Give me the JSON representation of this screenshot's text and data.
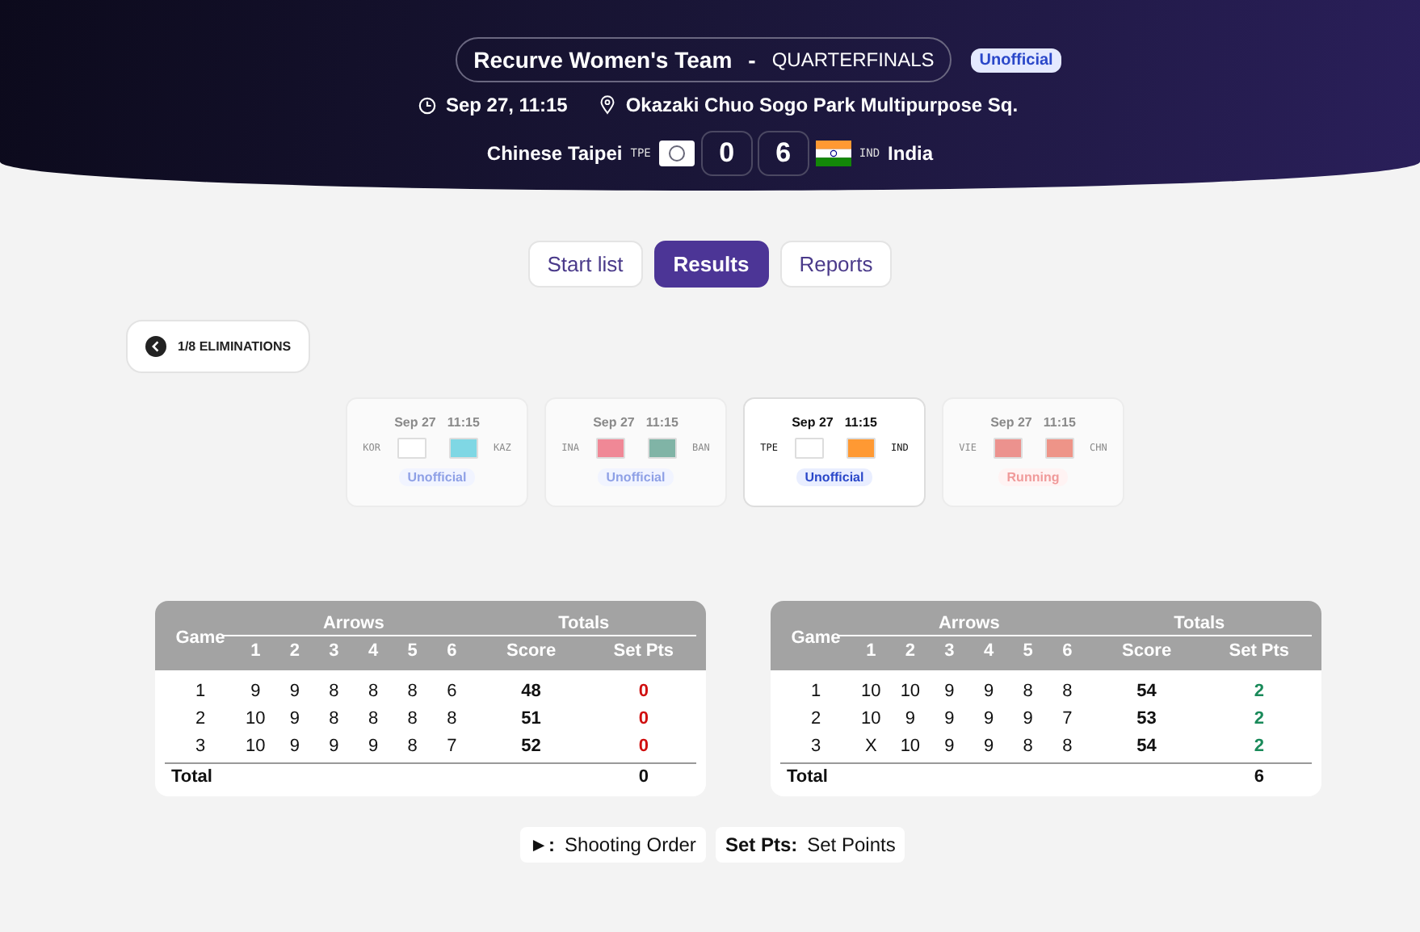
{
  "header": {
    "event": "Recurve Women's Team",
    "separator": "-",
    "phase": "QUARTERFINALS",
    "status": "Unofficial",
    "datetime": "Sep 27, 11:15",
    "venue": "Okazaki Chuo Sogo Park Multipurpose Sq.",
    "team_a": {
      "name": "Chinese Taipei",
      "code": "TPE",
      "score": "0"
    },
    "team_b": {
      "name": "India",
      "code": "IND",
      "score": "6"
    }
  },
  "tabs": [
    {
      "label": "Start list",
      "selected": false
    },
    {
      "label": "Results",
      "selected": true
    },
    {
      "label": "Reports",
      "selected": false
    }
  ],
  "back_button": {
    "label": "1/8 ELIMINATIONS"
  },
  "matches": [
    {
      "date": "Sep 27",
      "time": "11:15",
      "team_a": {
        "code": "KOR",
        "color": "#ffffff"
      },
      "team_b": {
        "code": "KAZ",
        "color": "#7fd7e4"
      },
      "status": {
        "label": "Unofficial",
        "kind": "unofficial"
      },
      "selected": false
    },
    {
      "date": "Sep 27",
      "time": "11:15",
      "team_a": {
        "code": "INA",
        "color": "#f08896"
      },
      "team_b": {
        "code": "BAN",
        "color": "#80b4a6"
      },
      "status": {
        "label": "Unofficial",
        "kind": "unofficial"
      },
      "selected": false
    },
    {
      "date": "Sep 27",
      "time": "11:15",
      "team_a": {
        "code": "TPE",
        "color": "#ffffff"
      },
      "team_b": {
        "code": "IND",
        "color": "#ff9933"
      },
      "status": {
        "label": "Unofficial",
        "kind": "unofficial"
      },
      "selected": true
    },
    {
      "date": "Sep 27",
      "time": "11:15",
      "team_a": {
        "code": "VIE",
        "color": "#ec928e"
      },
      "team_b": {
        "code": "CHN",
        "color": "#ee9488"
      },
      "status": {
        "label": "Running",
        "kind": "running"
      },
      "selected": false
    }
  ],
  "scorecards": [
    {
      "head": {
        "game": "Game",
        "arrows": "Arrows",
        "totals": "Totals",
        "arrow_numbers": [
          "1",
          "2",
          "3",
          "4",
          "5",
          "6"
        ],
        "score": "Score",
        "set_pts": "Set Pts"
      },
      "rows": [
        {
          "game": "1",
          "arrows": [
            "9",
            "9",
            "8",
            "8",
            "8",
            "6"
          ],
          "score": "48",
          "set_pts": "0",
          "won": false
        },
        {
          "game": "2",
          "arrows": [
            "10",
            "9",
            "8",
            "8",
            "8",
            "8"
          ],
          "score": "51",
          "set_pts": "0",
          "won": false
        },
        {
          "game": "3",
          "arrows": [
            "10",
            "9",
            "9",
            "9",
            "8",
            "7"
          ],
          "score": "52",
          "set_pts": "0",
          "won": false
        }
      ],
      "total_label": "Total",
      "total": "0"
    },
    {
      "head": {
        "game": "Game",
        "arrows": "Arrows",
        "totals": "Totals",
        "arrow_numbers": [
          "1",
          "2",
          "3",
          "4",
          "5",
          "6"
        ],
        "score": "Score",
        "set_pts": "Set Pts"
      },
      "rows": [
        {
          "game": "1",
          "arrows": [
            "10",
            "10",
            "9",
            "9",
            "8",
            "8"
          ],
          "score": "54",
          "set_pts": "2",
          "won": true
        },
        {
          "game": "2",
          "arrows": [
            "10",
            "9",
            "9",
            "9",
            "9",
            "7"
          ],
          "score": "53",
          "set_pts": "2",
          "won": true
        },
        {
          "game": "3",
          "arrows": [
            "X",
            "10",
            "9",
            "9",
            "8",
            "8"
          ],
          "score": "54",
          "set_pts": "2",
          "won": true
        }
      ],
      "total_label": "Total",
      "total": "6"
    }
  ],
  "legend": [
    {
      "key": "►:",
      "text": "Shooting Order"
    },
    {
      "key": "Set Pts:",
      "text": "Set Points"
    }
  ]
}
